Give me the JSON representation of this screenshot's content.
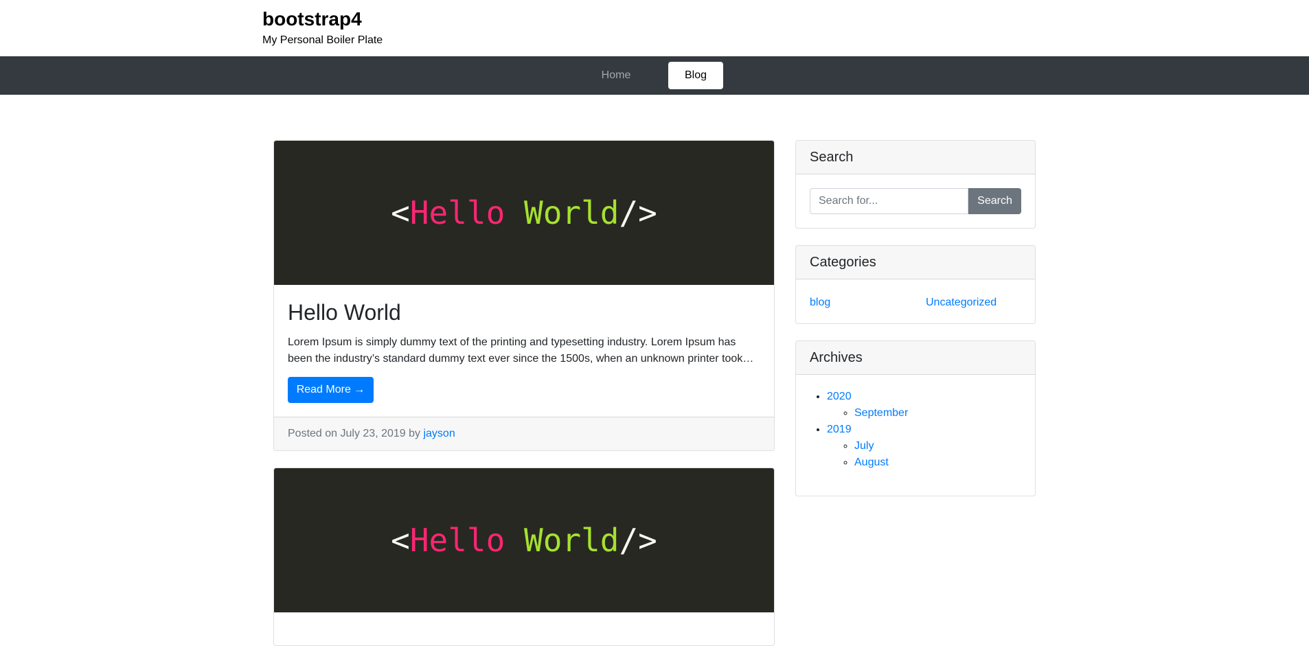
{
  "site": {
    "title": "bootstrap4",
    "tagline": "My Personal Boiler Plate"
  },
  "nav": {
    "items": [
      {
        "label": "Home",
        "active": false
      },
      {
        "label": "Blog",
        "active": true
      }
    ]
  },
  "posts": [
    {
      "image_text": {
        "open": "<",
        "word1": "Hello",
        "space": " ",
        "word2": "World",
        "close": "/>"
      },
      "title": "Hello World",
      "excerpt_line1": "Lorem Ipsum is simply dummy text of the printing and typesetting industry. Lorem Ipsum has",
      "excerpt_line2": "been the industry’s standard dummy text ever since the 1500s, when an unknown printer took…",
      "read_more": "Read More →",
      "posted_prefix": "Posted on July 23, 2019 by ",
      "author": "jayson"
    },
    {
      "image_text": {
        "open": "<",
        "word1": "Hello",
        "space": " ",
        "word2": "World",
        "close": "/>"
      }
    }
  ],
  "sidebar": {
    "search": {
      "title": "Search",
      "placeholder": "Search for...",
      "button": "Search"
    },
    "categories": {
      "title": "Categories",
      "items": [
        "blog",
        "Uncategorized"
      ]
    },
    "archives": {
      "title": "Archives",
      "years": [
        {
          "year": "2020",
          "months": [
            "September"
          ]
        },
        {
          "year": "2019",
          "months": [
            "July",
            "August"
          ]
        }
      ]
    }
  },
  "colors": {
    "navbar": "#343a40",
    "primary": "#007bff",
    "secondary": "#6c757d",
    "code_bg": "#272822",
    "code_pink": "#f92672",
    "code_green": "#a6e22e"
  }
}
